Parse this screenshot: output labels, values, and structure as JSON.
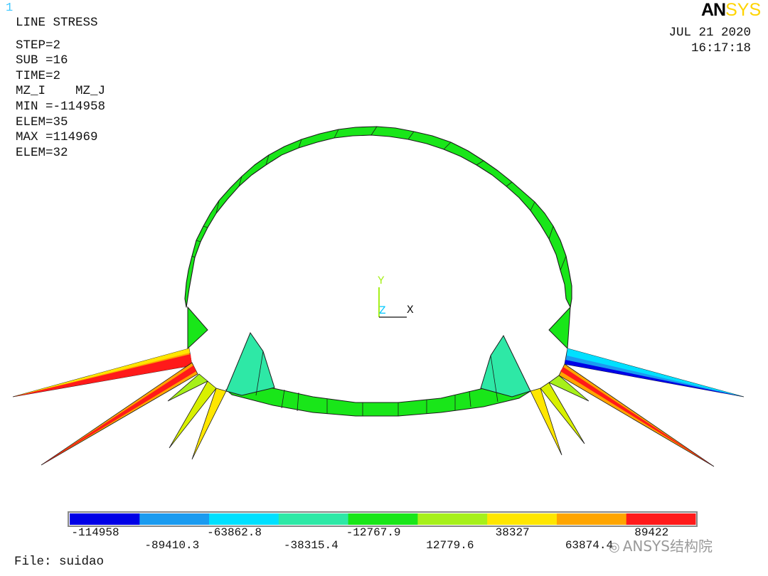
{
  "window_number": "1",
  "logo": {
    "part1": "AN",
    "part2": "SYS"
  },
  "info": {
    "title": "LINE STRESS",
    "step": "STEP=2",
    "sub": "SUB =16",
    "time": "TIME=2",
    "items": "MZ_I    MZ_J",
    "min": "MIN =-114958",
    "min_elem": "ELEM=35",
    "max": "MAX =114969",
    "max_elem": "ELEM=32"
  },
  "datetime": {
    "date": "JUL 21 2020",
    "time": "16:17:18"
  },
  "axes": {
    "y": "Y",
    "z": "Z",
    "x": "X"
  },
  "legend": {
    "colors": [
      "#0000e6",
      "#1a9bf0",
      "#00e0ff",
      "#2ee8a6",
      "#19e619",
      "#a6f01a",
      "#ffe600",
      "#ffa500",
      "#ff1a1a"
    ],
    "labels_top": [
      "-114958",
      "-63862.8",
      "-12767.9",
      "38327",
      "89422"
    ],
    "labels_bottom": [
      "-89410.3",
      "-38315.4",
      "12779.6",
      "63874.4"
    ]
  },
  "file": "File: suidao",
  "watermark": "ANSYS结构院"
}
